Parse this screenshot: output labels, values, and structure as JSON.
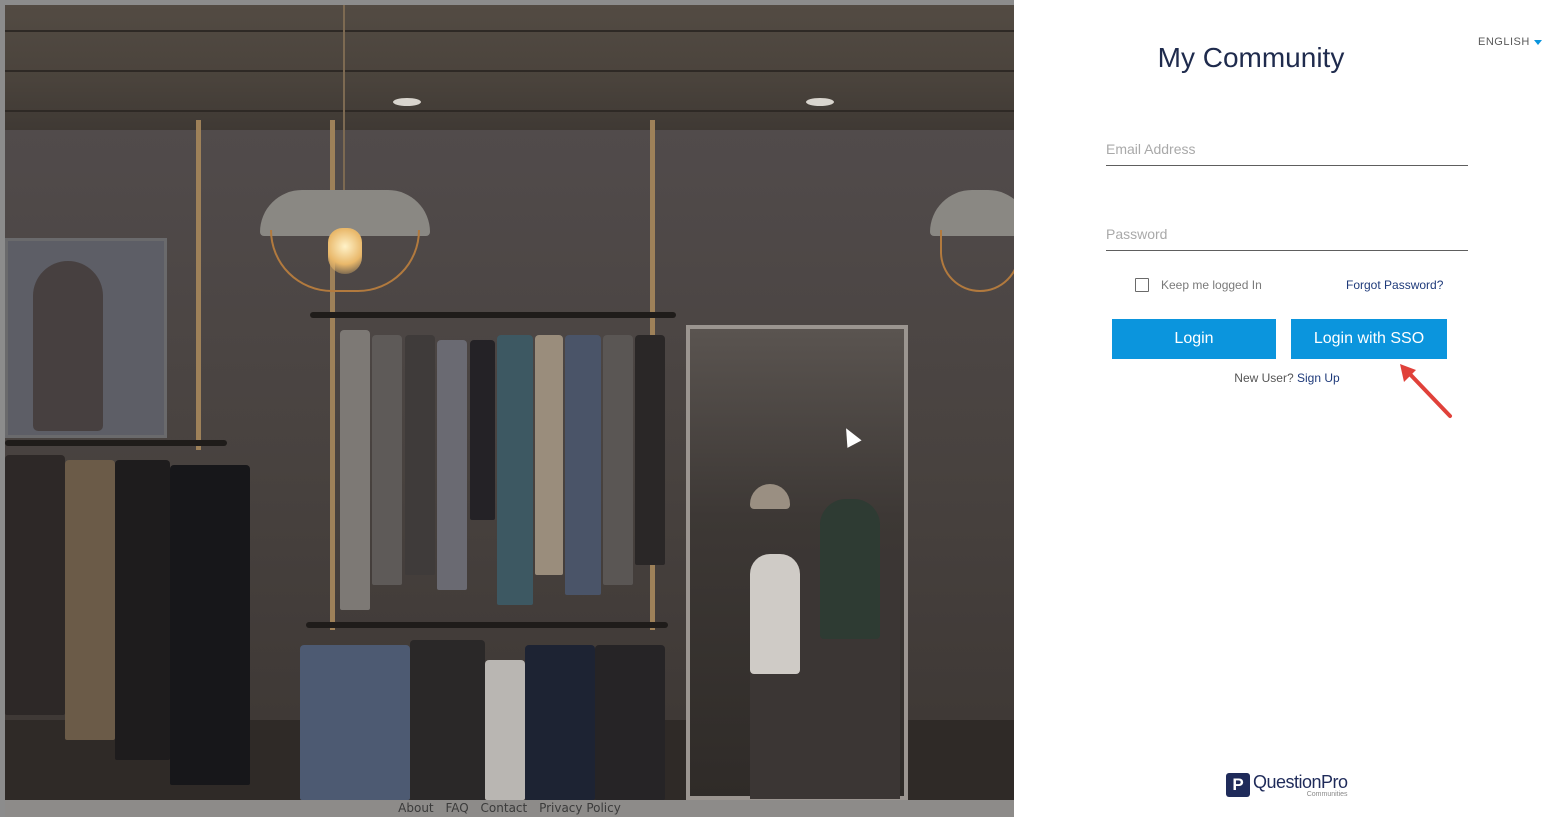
{
  "hero": {
    "description_alt": "Clothing store interior"
  },
  "footer": {
    "links": [
      "About",
      "FAQ",
      "Contact",
      "Privacy Policy"
    ]
  },
  "language": {
    "selected": "ENGLISH"
  },
  "login": {
    "title": "My Community",
    "email_placeholder": "Email Address",
    "password_placeholder": "Password",
    "remember_label": "Keep me logged In",
    "forgot_label": "Forgot Password?",
    "login_button": "Login",
    "sso_button": "Login with SSO",
    "new_user_text": "New User?",
    "signup_link": "Sign Up"
  },
  "brand": {
    "name": "QuestionPro",
    "sub": "Communities",
    "mark": "P"
  },
  "colors": {
    "accent": "#0b95dd",
    "title": "#1f2b4d",
    "link": "#1e3a7a",
    "annotation_arrow": "#e0413a"
  }
}
